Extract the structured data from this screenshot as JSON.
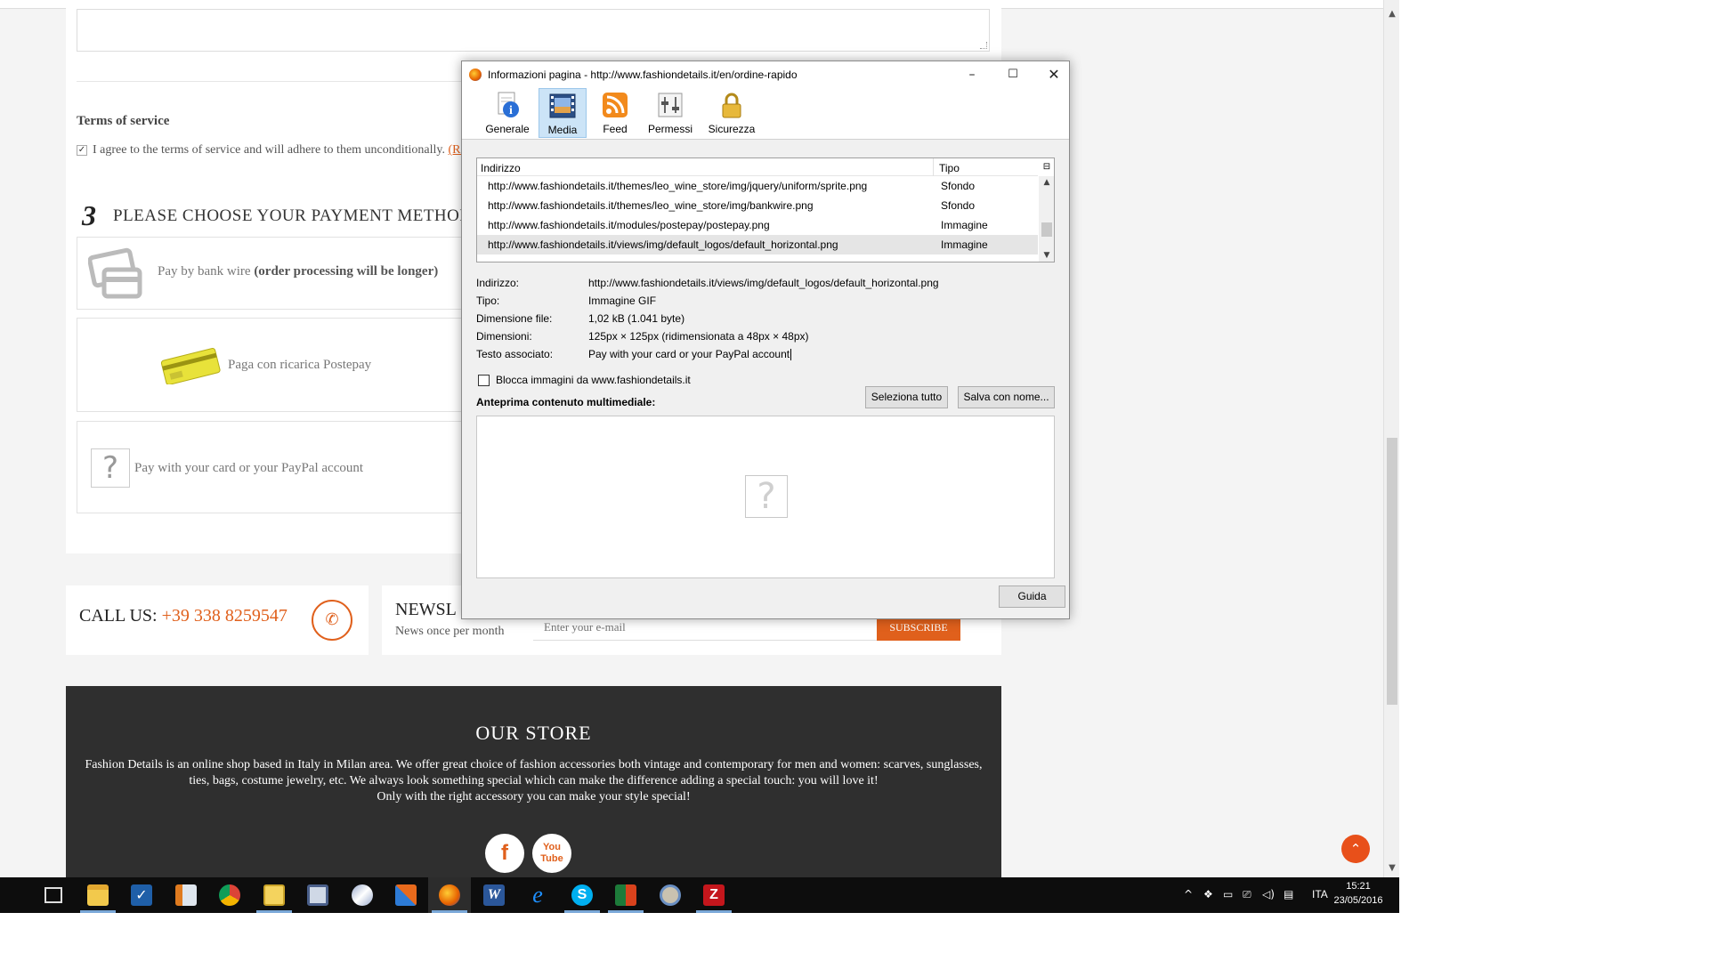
{
  "page": {
    "terms_title": "Terms of service",
    "terms_text": "I agree to the terms of service and will adhere to them unconditionally.",
    "terms_link": "(Re",
    "step_number": "3",
    "step_title": "PLEASE CHOOSE YOUR PAYMENT METHOD",
    "payment_methods": [
      {
        "label": "Pay by bank wire",
        "note": "(order processing will be longer)"
      },
      {
        "label": "Paga con ricarica Postepay"
      },
      {
        "label": "Pay with your card or your PayPal account"
      }
    ],
    "call_label": "CALL US:",
    "call_number": "+39 338 8259547",
    "newsletter_title": "NEWSL",
    "newsletter_sub": "News once per month",
    "newsletter_placeholder": "Enter your e-mail",
    "newsletter_button": "SUBSCRIBE",
    "store_title": "OUR STORE",
    "store_text_1": "Fashion Details is an online shop based in Italy in Milan area. We offer great choice of fashion accessories both vintage and contemporary for men and women: scarves, sunglasses,",
    "store_text_2": "ties, bags, costume jewelry, etc. We always look something special which can make the difference adding a special touch: you will love it!",
    "store_text_3": "Only with the right accessory you can make your style special!",
    "social_facebook": "f",
    "social_youtube_1": "You",
    "social_youtube_2": "Tube"
  },
  "dialog": {
    "title": "Informazioni pagina - http://www.fashiondetails.it/en/ordine-rapido",
    "tabs": [
      "Generale",
      "Media",
      "Feed",
      "Permessi",
      "Sicurezza"
    ],
    "active_tab": "Media",
    "columns": {
      "address": "Indirizzo",
      "type": "Tipo"
    },
    "rows": [
      {
        "address": "http://www.fashiondetails.it/themes/leo_wine_store/img/jquery/uniform/sprite.png",
        "type": "Sfondo"
      },
      {
        "address": "http://www.fashiondetails.it/themes/leo_wine_store/img/bankwire.png",
        "type": "Sfondo"
      },
      {
        "address": "http://www.fashiondetails.it/modules/postepay/postepay.png",
        "type": "Immagine"
      },
      {
        "address": "http://www.fashiondetails.it/views/img/default_logos/default_horizontal.png",
        "type": "Immagine"
      }
    ],
    "selected_row": 3,
    "props": {
      "address_label": "Indirizzo:",
      "address_value": "http://www.fashiondetails.it/views/img/default_logos/default_horizontal.png",
      "type_label": "Tipo:",
      "type_value": "Immagine GIF",
      "size_label": "Dimensione file:",
      "size_value": "1,02 kB (1.041 byte)",
      "dims_label": "Dimensioni:",
      "dims_value": "125px × 125px (ridimensionata a 48px × 48px)",
      "alt_label": "Testo associato:",
      "alt_value": "Pay with your card or your PayPal account"
    },
    "block_images_label": "Blocca immagini da www.fashiondetails.it",
    "block_images_checked": false,
    "select_all_label": "Seleziona tutto",
    "save_as_label": "Salva con nome...",
    "preview_label": "Anteprima contenuto multimediale:",
    "help_label": "Guida"
  },
  "taskbar": {
    "language": "ITA",
    "time": "15:21",
    "date": "23/05/2016",
    "apps": [
      "file-explorer",
      "tasks",
      "media-player",
      "chrome",
      "sticky-notes",
      "remote-desktop",
      "onenote",
      "snipping-tool",
      "firefox",
      "word",
      "internet-explorer",
      "skype",
      "excel-flash",
      "paint",
      "filezilla"
    ]
  },
  "colors": {
    "accent": "#e0601c",
    "footer_bg": "#2f2f2f",
    "page_bg": "#f4f4f4",
    "taskbar_bg": "#0d0d0d",
    "selected_tab_bg": "#cce4f7"
  }
}
